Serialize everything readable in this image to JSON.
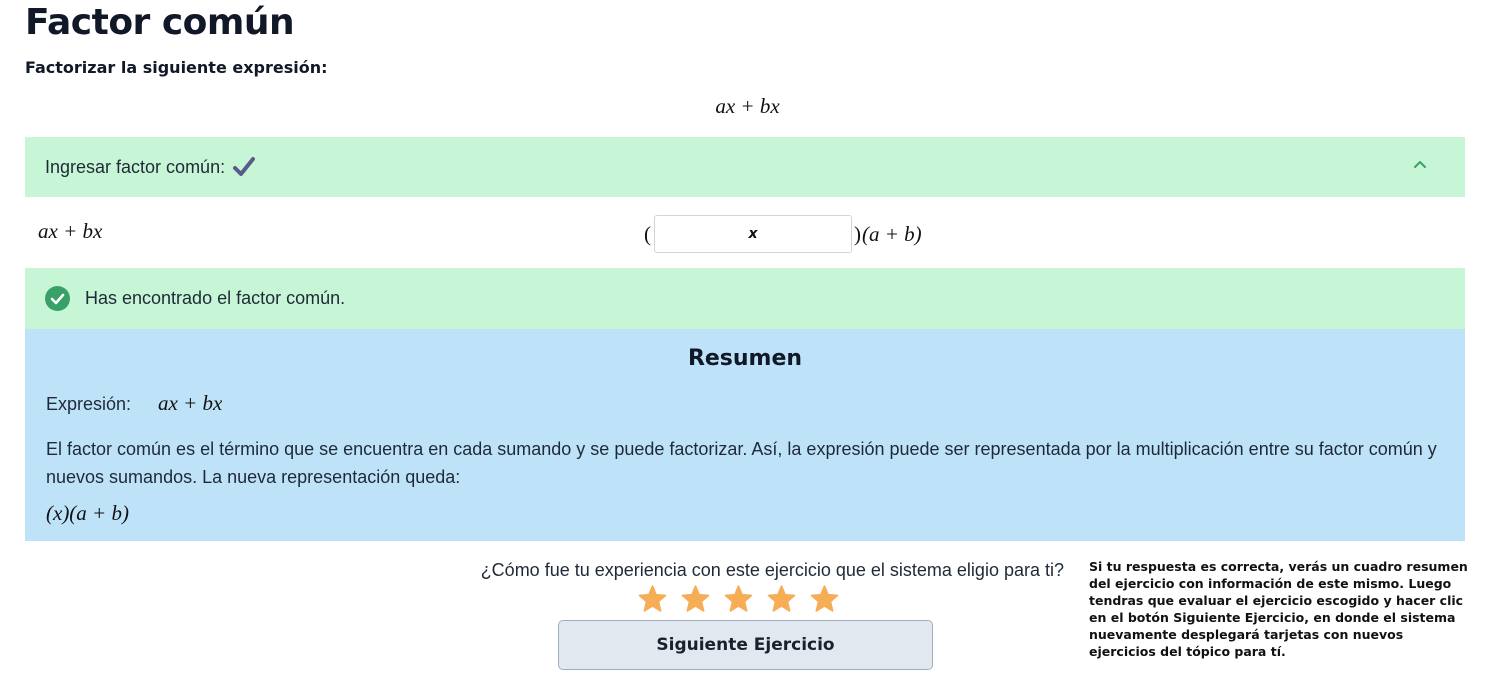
{
  "page": {
    "title": "Factor común",
    "instruction": "Factorizar la siguiente expresión:",
    "expression": "ax + bx"
  },
  "step": {
    "header_label": "Ingresar factor común:",
    "status_icon": "check-icon",
    "expanded": true,
    "left_expression": "ax + bx",
    "open_paren": "(",
    "close_paren": ")",
    "input_value": "x",
    "rest_expression": "(a + b)"
  },
  "feedback": {
    "icon": "check-circle-icon",
    "message": "Has encontrado el factor común."
  },
  "summary": {
    "title": "Resumen",
    "expression_label": "Expresión:",
    "expression": "ax + bx",
    "description": "El factor común es el término que se encuentra en cada sumando y se puede factorizar. Así, la expresión puede ser representada por la multiplicación entre su factor común y nuevos sumandos. La nueva representación queda:",
    "result": "(x)(a + b)"
  },
  "rating": {
    "question": "¿Cómo fue tu experiencia con este ejercicio que el sistema eligio para ti?",
    "stars": 5
  },
  "next_button_label": "Siguiente Ejercicio",
  "annotation": "Si tu respuesta es correcta, verás un cuadro resumen del ejercicio con información de este mismo. Luego tendras que evaluar el ejercicio escogido y hacer clic en el botón Siguiente Ejercicio, en donde el sistema nuevamente desplegará tarjetas con nuevos ejercicios del tópico para tí.",
  "colors": {
    "success_bg": "#c6f6d5",
    "summary_bg": "#bee3f8",
    "star": "#f6ad55",
    "check": "#5a5a8c",
    "success_icon": "#38a169"
  }
}
